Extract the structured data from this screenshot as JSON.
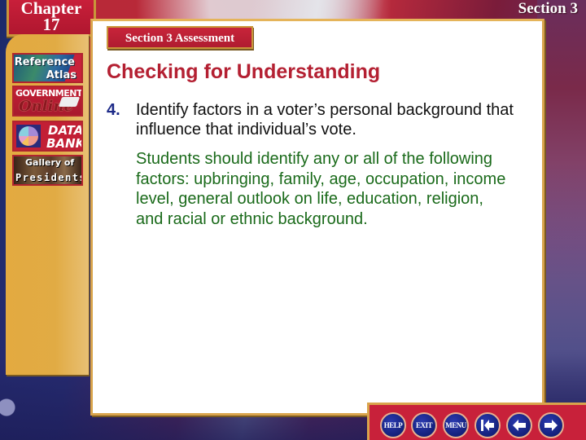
{
  "chapter": {
    "label": "Chapter",
    "number": "17"
  },
  "section_label": "Section 3",
  "sidebar": {
    "items": [
      {
        "id": "reference-atlas",
        "line1": "Reference",
        "line2": "Atlas"
      },
      {
        "id": "government-online",
        "line1": "GOVERNMENT",
        "line2": "Online"
      },
      {
        "id": "data-bank",
        "line1": "DATA",
        "line2": "BANK"
      },
      {
        "id": "gallery-of-presidents",
        "line1": "Gallery of",
        "line2": "Presidents"
      }
    ]
  },
  "assessment_tab": "Section 3 Assessment",
  "heading": "Checking for Understanding",
  "question": {
    "number": "4.",
    "text": "Identify factors in a voter’s personal background that influence that individual’s vote."
  },
  "answer": "Students should identify any or all of the following factors: upbringing, family, age, occupation, income level, general outlook on life, education, religion, and racial or ethnic background.",
  "nav": {
    "help": "HELP",
    "exit": "EXIT",
    "menu": "MENU",
    "first_icon": "first-slide-icon",
    "prev_icon": "previous-arrow-icon",
    "next_icon": "next-arrow-icon"
  },
  "colors": {
    "heading": "#b42032",
    "question_number": "#1d2a88",
    "answer_text": "#1a6a1a",
    "tab_red": "#c8213a",
    "gold": "#e1ab44",
    "nav_button_blue": "#14207a"
  }
}
